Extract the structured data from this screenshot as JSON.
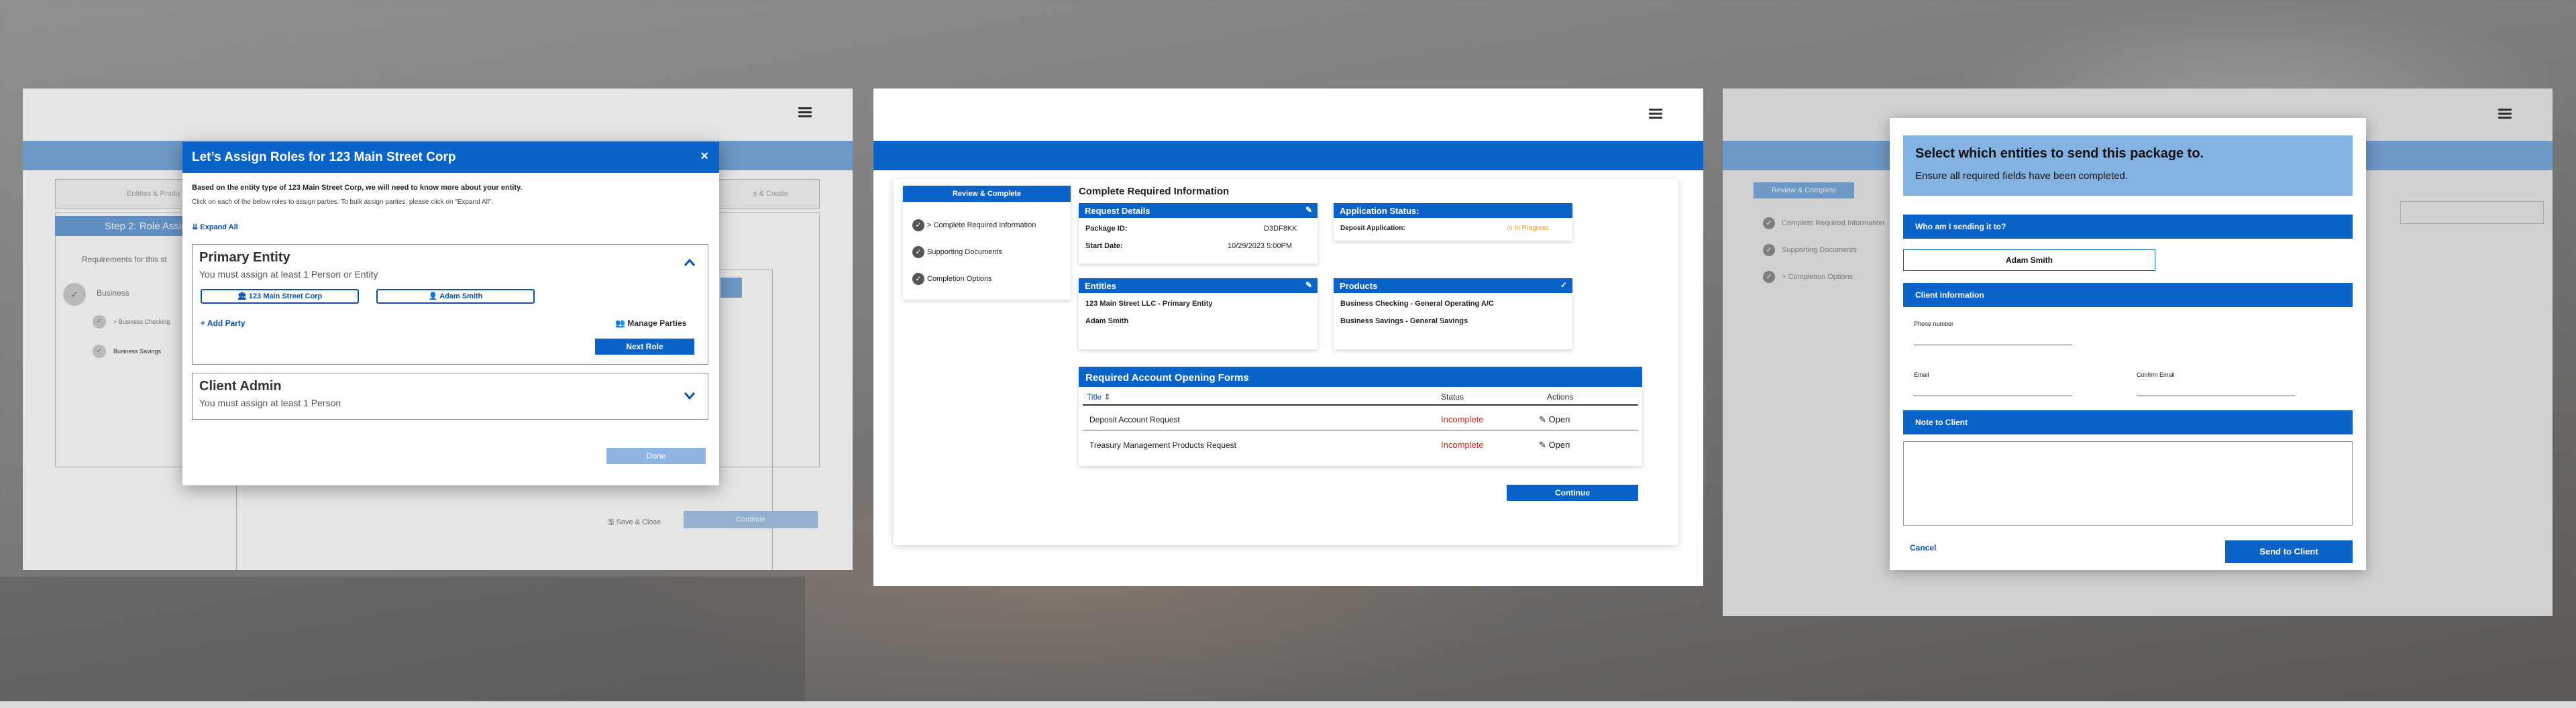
{
  "panel1": {
    "steps": [
      "Entities & Produ",
      "s & Create"
    ],
    "step2_label": "Step 2: Role Assignme",
    "requirements": "Requirements for this st",
    "business": "Business",
    "business_checking": "> Business Checking",
    "business_savings": "Business Savings",
    "save_close": "Save & Close",
    "continue": "Continue",
    "modal": {
      "title": "Let’s Assign Roles for 123 Main Street Corp",
      "close": "×",
      "intro": "Based on the entity type of 123 Main Street Corp, we will need to know more about your entity.",
      "intro2": "Click on each of the below roles to assign parties.  To bulk assign parties, please click on \"Expand All\".",
      "expand_all": "Expand All",
      "primary": {
        "title": "Primary Entity",
        "sub": "You must assign at least 1 Person or Entity",
        "party1": "123 Main Street Corp",
        "party2": "Adam Smith",
        "add_party": "Add Party",
        "manage_parties": "Manage Parties",
        "next_role": "Next Role"
      },
      "client_admin": {
        "title": "Client Admin",
        "sub": "You must assign at least 1 Person"
      },
      "done": "Done"
    }
  },
  "panel2": {
    "sidebar": {
      "header": "Review & Complete",
      "items": [
        "> Complete Required Information",
        "Supporting Documents",
        "Completion Options"
      ]
    },
    "heading": "Complete Required Information",
    "request_details": {
      "title": "Request Details",
      "package_label": "Package ID:",
      "package_value": "D3DF8KK",
      "start_label": "Start Date:",
      "start_value": "10/29/2023  5:00PM"
    },
    "app_status": {
      "title": "Application Status:",
      "deposit_label": "Deposit Application:",
      "deposit_value": "In Progress"
    },
    "entities": {
      "title": "Entities",
      "items": [
        "123 Main Street LLC - Primary Entity",
        "Adam Smith"
      ]
    },
    "products": {
      "title": "Products",
      "items": [
        "Business Checking - General Operating A/C",
        "Business Savings - General Savings"
      ]
    },
    "forms": {
      "title": "Required Account Opening Forms",
      "columns": [
        "Title",
        "Status",
        "Actions"
      ],
      "rows": [
        {
          "title": "Deposit Account Request",
          "status": "Incomplete",
          "action": "Open"
        },
        {
          "title": "Treasury Management Products Request",
          "status": "Incomplete",
          "action": "Open"
        }
      ]
    },
    "continue": "Continue"
  },
  "panel3": {
    "sidebar": {
      "header": "Review & Complete",
      "items": [
        "Complete Required Information",
        "Supporting Documents",
        "> Completion Options"
      ]
    },
    "dialog": {
      "title": "Select which entities to send this package to.",
      "subtitle": "Ensure all required fields have been completed.",
      "who": "Who am I sending it to?",
      "name": "Adam Smith",
      "client_info": "Client information",
      "phone_label": "Phone number",
      "email_label": "Email",
      "confirm_email_label": "Confirm Email",
      "note": "Note to Client",
      "cancel": "Cancel",
      "send": "Send to Client"
    }
  },
  "colors": {
    "primary": "#0a63c9",
    "light_primary": "#7aa9dc",
    "incomplete": "#e0201b",
    "in_progress": "#f08c1a"
  }
}
